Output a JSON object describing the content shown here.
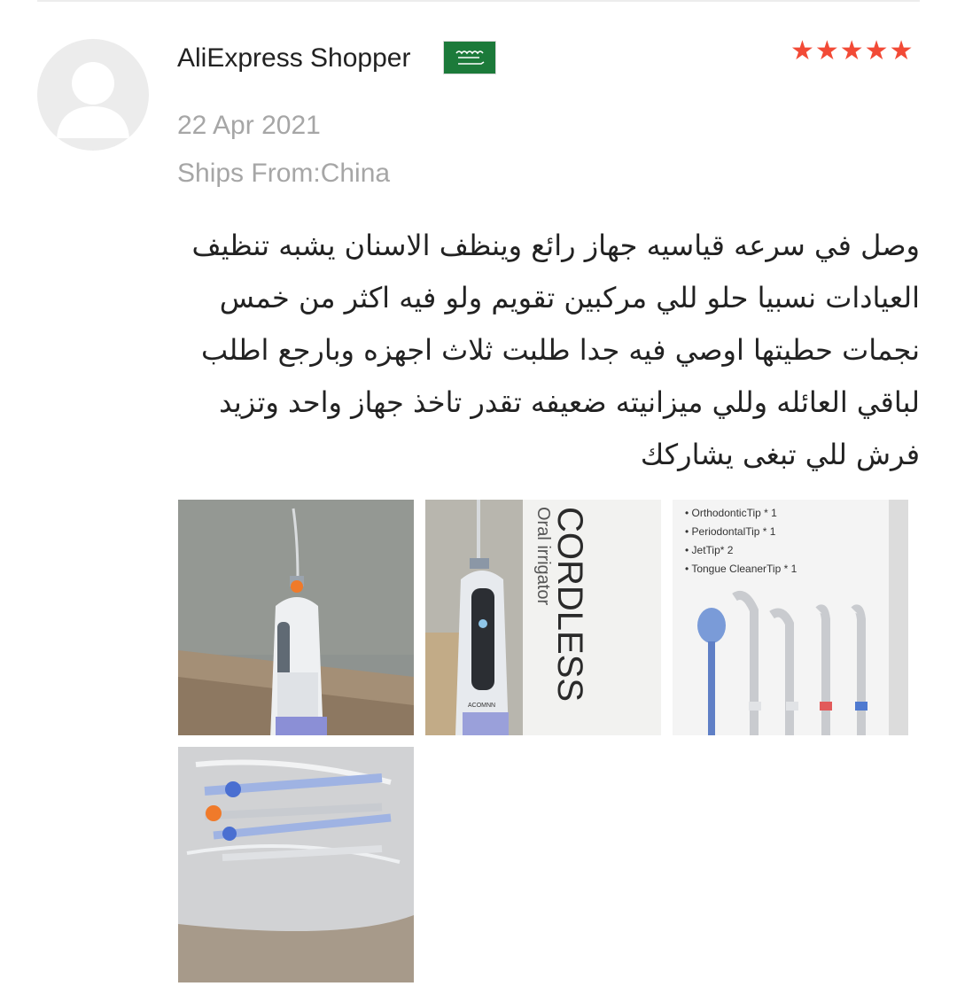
{
  "review": {
    "reviewer_name": "AliExpress Shopper",
    "country_flag": "Saudi Arabia",
    "rating": 5,
    "rating_stars": "★★★★★",
    "date": "22 Apr 2021",
    "ships_from": "Ships From:China",
    "text": "وصل في سرعه قياسيه جهاز رائع وينظف الاسنان يشبه تنظيف العيادات نسبيا حلو للي مركبين تقويم ولو فيه اكثر من خمس نجمات حطيتها اوصي فيه جدا طلبت ثلاث اجهزه وبارجع اطلب لباقي العائله وللي ميزانيته ضعيفه تقدر تاخذ جهاز واحد وتزيد فرش للي تبغى يشاركك"
  },
  "photos": {
    "photo2": {
      "box_title": "CORDLESS",
      "box_subtitle": "Oral irrigator",
      "device_brand": "ACOMNN"
    },
    "photo3": {
      "tip_list": [
        "• OrthodonticTip * 1",
        "• PeriodontalTip * 1",
        "• JetTip* 2",
        "• Tongue CleanerTip * 1"
      ]
    }
  },
  "colors": {
    "star": "#f24a36",
    "muted_text": "#a6a6a6",
    "flag_green": "#1c7a3a"
  }
}
